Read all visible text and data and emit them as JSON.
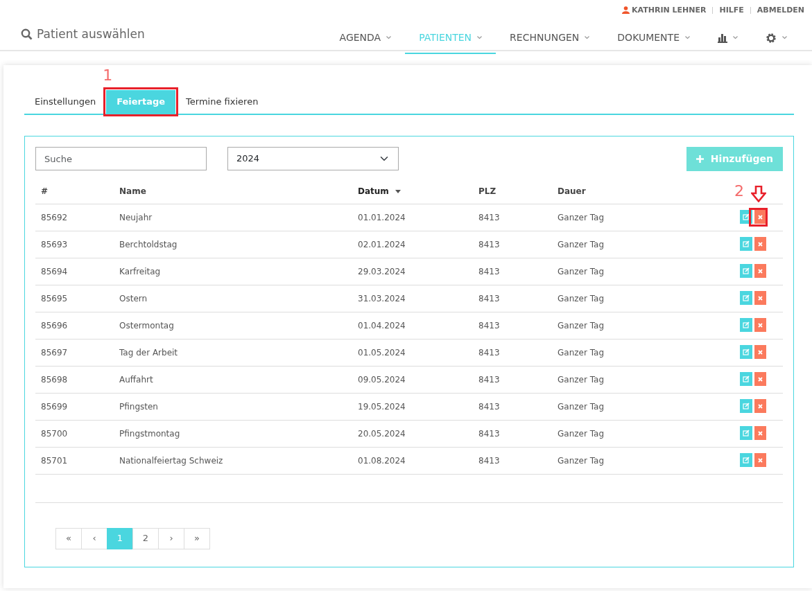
{
  "top_links": [
    {
      "label": "KATHRIN LEHNER",
      "kind": "user"
    },
    {
      "label": "HILFE",
      "kind": "link"
    },
    {
      "label": "ABMELDEN",
      "kind": "link"
    }
  ],
  "patient_search": {
    "label": "Patient auswählen"
  },
  "nav": [
    {
      "label": "AGENDA",
      "kind": "text",
      "selected": false
    },
    {
      "label": "PATIENTEN",
      "kind": "text",
      "selected": true
    },
    {
      "label": "RECHNUNGEN",
      "kind": "text",
      "selected": false
    },
    {
      "label": "DOKUMENTE",
      "kind": "text",
      "selected": false
    },
    {
      "kind": "chart",
      "selected": false
    },
    {
      "kind": "gear",
      "selected": false
    }
  ],
  "tabs": [
    {
      "label": "Einstellungen",
      "selected": false
    },
    {
      "label": "Feiertage",
      "selected": true,
      "annotation": "1"
    },
    {
      "label": "Termine fixieren",
      "selected": false
    }
  ],
  "search": {
    "placeholder": "Suche"
  },
  "year_select": {
    "value": "2024"
  },
  "add_button": {
    "label": "Hinzufügen"
  },
  "table": {
    "columns": [
      {
        "label": "#",
        "sorted": false
      },
      {
        "label": "Name",
        "sorted": false
      },
      {
        "label": "Datum",
        "sorted": true
      },
      {
        "label": "PLZ",
        "sorted": false
      },
      {
        "label": "Dauer",
        "sorted": false
      }
    ],
    "rows": [
      {
        "cells": [
          "85692",
          "Neujahr",
          "01.01.2024",
          "8413",
          "Ganzer Tag"
        ],
        "annotation": "2"
      },
      {
        "cells": [
          "85693",
          "Berchtoldstag",
          "02.01.2024",
          "8413",
          "Ganzer Tag"
        ]
      },
      {
        "cells": [
          "85694",
          "Karfreitag",
          "29.03.2024",
          "8413",
          "Ganzer Tag"
        ]
      },
      {
        "cells": [
          "85695",
          "Ostern",
          "31.03.2024",
          "8413",
          "Ganzer Tag"
        ]
      },
      {
        "cells": [
          "85696",
          "Ostermontag",
          "01.04.2024",
          "8413",
          "Ganzer Tag"
        ]
      },
      {
        "cells": [
          "85697",
          "Tag der Arbeit",
          "01.05.2024",
          "8413",
          "Ganzer Tag"
        ]
      },
      {
        "cells": [
          "85698",
          "Auffahrt",
          "09.05.2024",
          "8413",
          "Ganzer Tag"
        ]
      },
      {
        "cells": [
          "85699",
          "Pfingsten",
          "19.05.2024",
          "8413",
          "Ganzer Tag"
        ]
      },
      {
        "cells": [
          "85700",
          "Pfingstmontag",
          "20.05.2024",
          "8413",
          "Ganzer Tag"
        ]
      },
      {
        "cells": [
          "85701",
          "Nationalfeiertag Schweiz",
          "01.08.2024",
          "8413",
          "Ganzer Tag"
        ]
      }
    ]
  },
  "pagination": [
    {
      "label": "«",
      "selected": false
    },
    {
      "label": "‹",
      "selected": false
    },
    {
      "label": "1",
      "selected": true
    },
    {
      "label": "2",
      "selected": false
    },
    {
      "label": "›",
      "selected": false
    },
    {
      "label": "»",
      "selected": false
    }
  ]
}
